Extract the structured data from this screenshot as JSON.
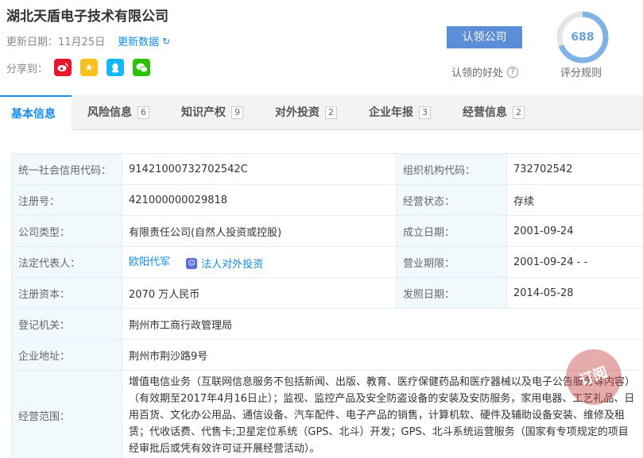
{
  "company": {
    "name": "湖北天盾电子技术有限公司",
    "update_label": "更新日期：11月25日",
    "update_link": "更新数据",
    "share_label": "分享到："
  },
  "share_icons": [
    "weibo-icon",
    "qzone-icon",
    "qq-icon",
    "wechat-icon"
  ],
  "claim": {
    "button_label": "认领公司",
    "benefit_label": "认领的好处"
  },
  "score": {
    "value": "688",
    "rule_label": "评分规则",
    "ring_fraction": 0.69
  },
  "tabs": [
    {
      "label": "基本信息",
      "count": ""
    },
    {
      "label": "风险信息",
      "count": "6"
    },
    {
      "label": "知识产权",
      "count": "9"
    },
    {
      "label": "对外投资",
      "count": "2"
    },
    {
      "label": "企业年报",
      "count": "3"
    },
    {
      "label": "经营信息",
      "count": "2"
    }
  ],
  "info": {
    "credit_code_label": "统一社会信用代码：",
    "credit_code": "91421000732702542C",
    "org_code_label": "组织机构代码：",
    "org_code": "732702542",
    "reg_no_label": "注册号：",
    "reg_no": "421000000029818",
    "status_label": "经营状态：",
    "status": "存续",
    "type_label": "公司类型：",
    "type": "有限责任公司(自然人投资或控股)",
    "founded_label": "成立日期：",
    "founded": "2001-09-24",
    "rep_label": "法定代表人：",
    "rep": "欧阳代军",
    "rep_invest": "法人对外投资",
    "term_label": "营业期限：",
    "term": "2001-09-24 - -",
    "capital_label": "注册资本：",
    "capital": "2070 万人民币",
    "issue_label": "发照日期：",
    "issue": "2014-05-28",
    "authority_label": "登记机关：",
    "authority": "荆州市工商行政管理局",
    "address_label": "企业地址：",
    "address": "荆州市荆沙路9号",
    "scope_label": "经营范围：",
    "scope": "增值电信业务（互联网信息服务不包括新闻、出版、教育、医疗保健药品和医疗器械以及电子公告服务等内容）（有效期至2017年4月16日止）；监视、监控产品及安全防盗设备的安装及安防服务，家用电器、工艺礼品、日用百货、文化办公用品、通信设备、汽车配件、电子产品的销售，计算机软、硬件及辅助设备安装、维修及租赁；代收话费、代售卡;卫星定位系统（GPS、北斗）开发；GPS、北斗系统运营服务（国家有专项规定的项目经审批后或凭有效许可证开展经营活动）。"
  },
  "watermark_text": "订阅"
}
